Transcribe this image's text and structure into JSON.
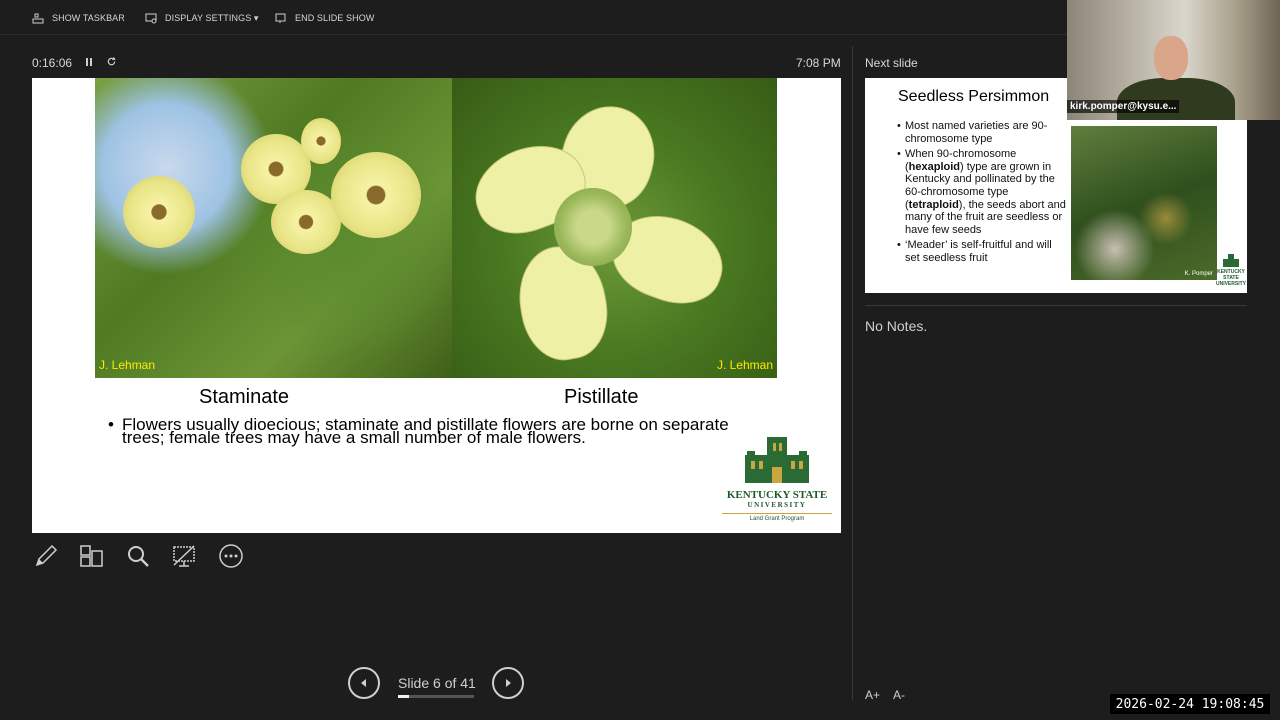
{
  "toolbar": {
    "show_taskbar": "SHOW TASKBAR",
    "display_settings": "DISPLAY SETTINGS ▾",
    "end_slide_show": "END SLIDE SHOW"
  },
  "presenter": {
    "elapsed_time": "0:16:06",
    "clock": "7:08 PM",
    "next_slide_label": "Next slide",
    "notes": "No Notes."
  },
  "current_slide": {
    "credit_left": "J. Lehman",
    "credit_right": "J. Lehman",
    "caption_left": "Staminate",
    "caption_right": "Pistillate",
    "bullet": "Flowers usually dioecious; staminate and pistillate flowers are borne on separate trees; female trees may have a small number of male flowers.",
    "logo_name": "KENTUCKY STATE",
    "logo_university": "UNIVERSITY",
    "logo_program": "Land Grant Program"
  },
  "next_slide": {
    "title": "Seedless Persimmon",
    "bullets": [
      "Most named varieties are 90-chromosome type",
      "When 90-chromosome (hexaploid) type are grown in Kentucky and pollinated by the 60-chromosome type (tetraploid), the seeds abort and many of the fruit are seedless or have few seeds",
      "‘Meader’ is self-fruitful and will set seedless fruit"
    ],
    "photo_credit": "K. Pomper",
    "logo_text": "KENTUCKY STATE UNIVERSITY"
  },
  "navigation": {
    "slide_indicator": "Slide 6 of 41",
    "progress": 0.146
  },
  "notes_font": {
    "increase": "A+",
    "decrease": "A-"
  },
  "webcam": {
    "name": "kirk.pomper@kysu.e..."
  },
  "timestamp": "2026-02-24 19:08:45",
  "colors": {
    "background": "#1d1d1d",
    "ksu_green": "#1f5a2b",
    "credit_yellow": "#ffea00"
  }
}
